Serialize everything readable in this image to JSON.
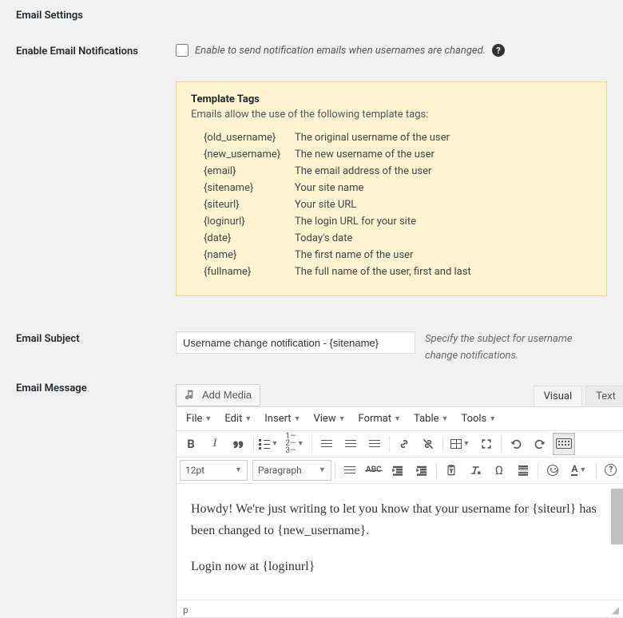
{
  "headings": {
    "email_settings": "Email Settings",
    "enable_notifications": "Enable Email Notifications",
    "email_subject": "Email Subject",
    "email_message": "Email Message"
  },
  "notifications": {
    "description": "Enable to send notification emails when usernames are changed."
  },
  "templateBox": {
    "title": "Template Tags",
    "subtitle": "Emails allow the use of the following template tags:",
    "tags": [
      {
        "tag": "{old_username}",
        "desc": "The original username of the user"
      },
      {
        "tag": "{new_username}",
        "desc": "The new username of the user"
      },
      {
        "tag": "{email}",
        "desc": "The email address of the user"
      },
      {
        "tag": "{sitename}",
        "desc": "Your site name"
      },
      {
        "tag": "{siteurl}",
        "desc": "Your site URL"
      },
      {
        "tag": "{loginurl}",
        "desc": "The login URL for your site"
      },
      {
        "tag": "{date}",
        "desc": "Today's date"
      },
      {
        "tag": "{name}",
        "desc": "The first name of the user"
      },
      {
        "tag": "{fullname}",
        "desc": "The full name of the user, first and last"
      }
    ]
  },
  "subject": {
    "value": "Username change notification - {sitename}",
    "description": "Specify the subject for username change notifications."
  },
  "media": {
    "button": "Add Media"
  },
  "tabs": {
    "visual": "Visual",
    "text": "Text"
  },
  "menubar": [
    "File",
    "Edit",
    "Insert",
    "View",
    "Format",
    "Table",
    "Tools"
  ],
  "dropdowns": {
    "fontsize": "12pt",
    "blockformat": "Paragraph"
  },
  "content": {
    "p1": "Howdy! We're just writing to let you know that your username for {siteurl} has been changed to {new_username}.",
    "p2": "Login now at {loginurl}"
  },
  "status": {
    "path": "p"
  },
  "help": {
    "q": "?"
  }
}
